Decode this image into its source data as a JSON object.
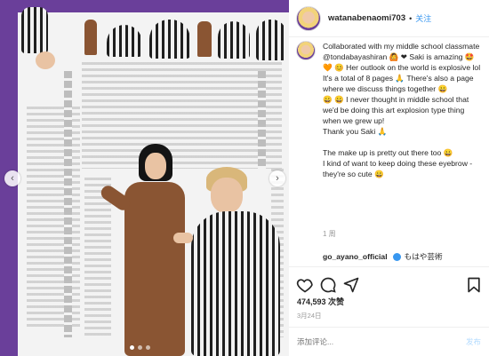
{
  "post": {
    "username": "watanabenaomi703",
    "separator": "•",
    "follow_label": "关注",
    "caption": "Collaborated with my middle school classmate @tondabayashiran 🙆 ❤ Saki is amazing 🤩 🧡 😊 Her outlook on the world is explosive lol It's a total of 8 pages 🙏 There's also a page where we discuss things together 😀\n😀 😀 I never thought in middle school that we'd be doing this art explosion type thing when we grew up!\nThank you Saki 🙏\n\nThe make up is pretty out there too 😀\nI kind of want to keep doing these eyebrow - they're so cute 😀",
    "caption_time": "1 周",
    "comment": {
      "user": "go_ayano_official",
      "text": "もはや芸術"
    },
    "likes": "474,593 次赞",
    "date": "3月24日",
    "add_comment_placeholder": "添加评论...",
    "post_button": "发布"
  },
  "carousel": {
    "slide_count": 3,
    "active_index": 0
  },
  "icons": {
    "like": "heart-icon",
    "comment": "comment-icon",
    "share": "share-icon",
    "save": "bookmark-icon",
    "verified": "verified-icon"
  },
  "colors": {
    "accent": "#3897f0",
    "border_purple": "#6a3f9a"
  }
}
